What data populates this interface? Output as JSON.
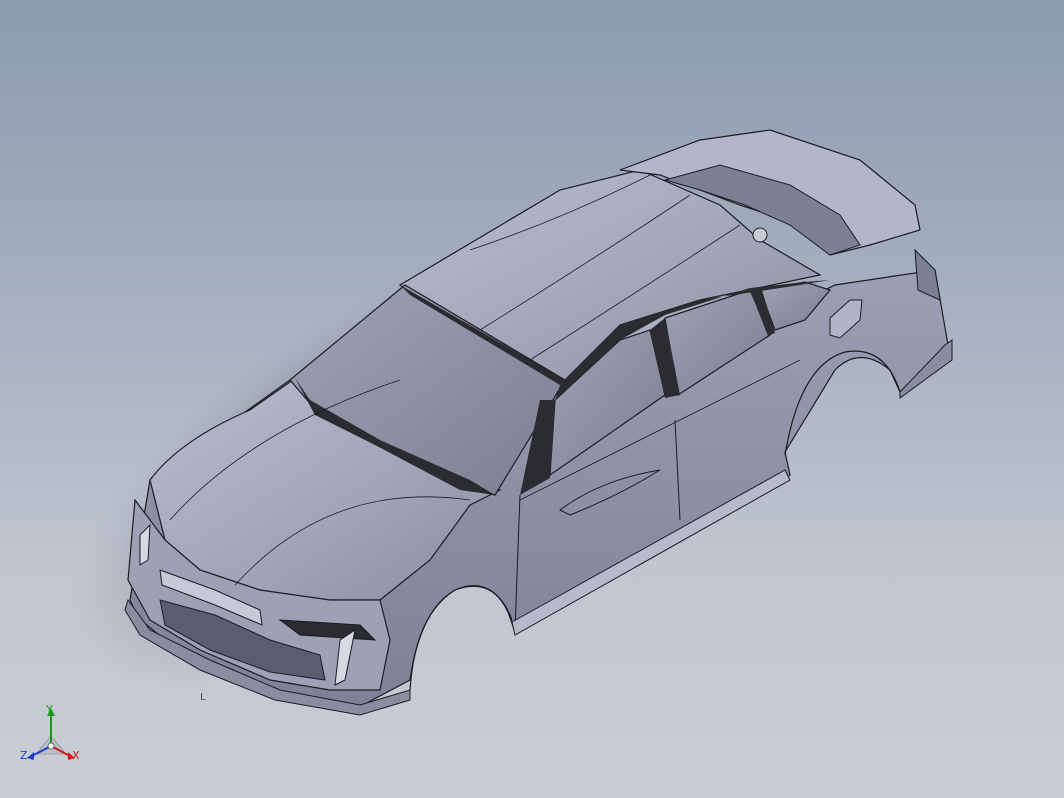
{
  "viewport": {
    "background_top": "#8c9bb0",
    "background_bottom": "#c9cdd5"
  },
  "model": {
    "body_color": "#a4a7bb",
    "glass_color": "#2b2b30",
    "edge_color": "#1c1c22"
  },
  "triad": {
    "x_label": "X",
    "y_label": "Y",
    "z_label": "Z",
    "x_color": "#cc1a1a",
    "y_color": "#1a9a1a",
    "z_color": "#1a3fcc"
  },
  "cursor_mark": "L"
}
